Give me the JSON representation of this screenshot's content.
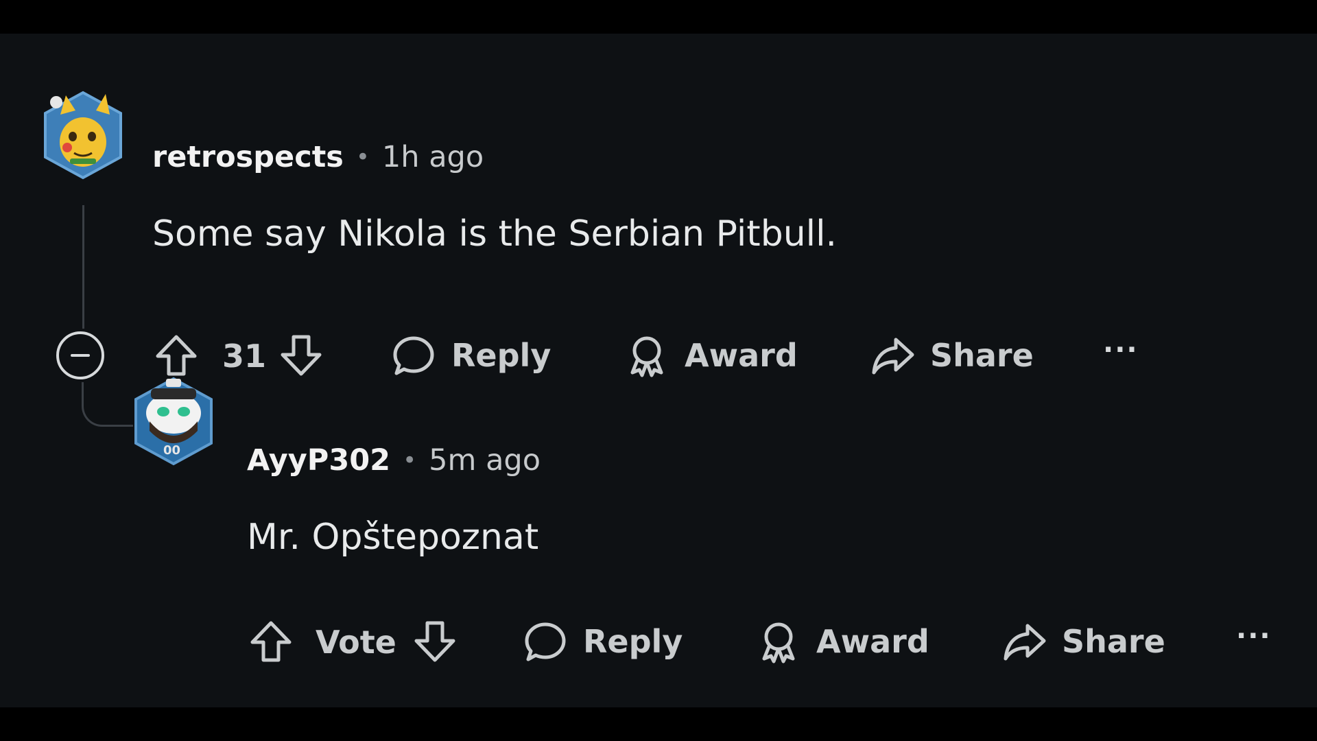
{
  "comments": [
    {
      "username": "retrospects",
      "separator": "•",
      "time": "1h ago",
      "body": "Some say Nikola is the Serbian Pitbull.",
      "votes": "31",
      "actions": {
        "reply": "Reply",
        "award": "Award",
        "share": "Share",
        "more": "···"
      },
      "avatar_icon": "snoo-avatar-icon"
    },
    {
      "username": "AyyP302",
      "separator": "•",
      "time": "5m ago",
      "body": "Mr. Opštepoznat",
      "votes": "Vote",
      "actions": {
        "reply": "Reply",
        "award": "Award",
        "share": "Share",
        "more": "···"
      },
      "avatar_icon": "snoo-avatar-icon",
      "avatar_badge": "00"
    }
  ],
  "colors": {
    "background": "#0e1114",
    "frame": "#000000",
    "text": "#d7dadc",
    "thread_line": "#3a3f45"
  }
}
